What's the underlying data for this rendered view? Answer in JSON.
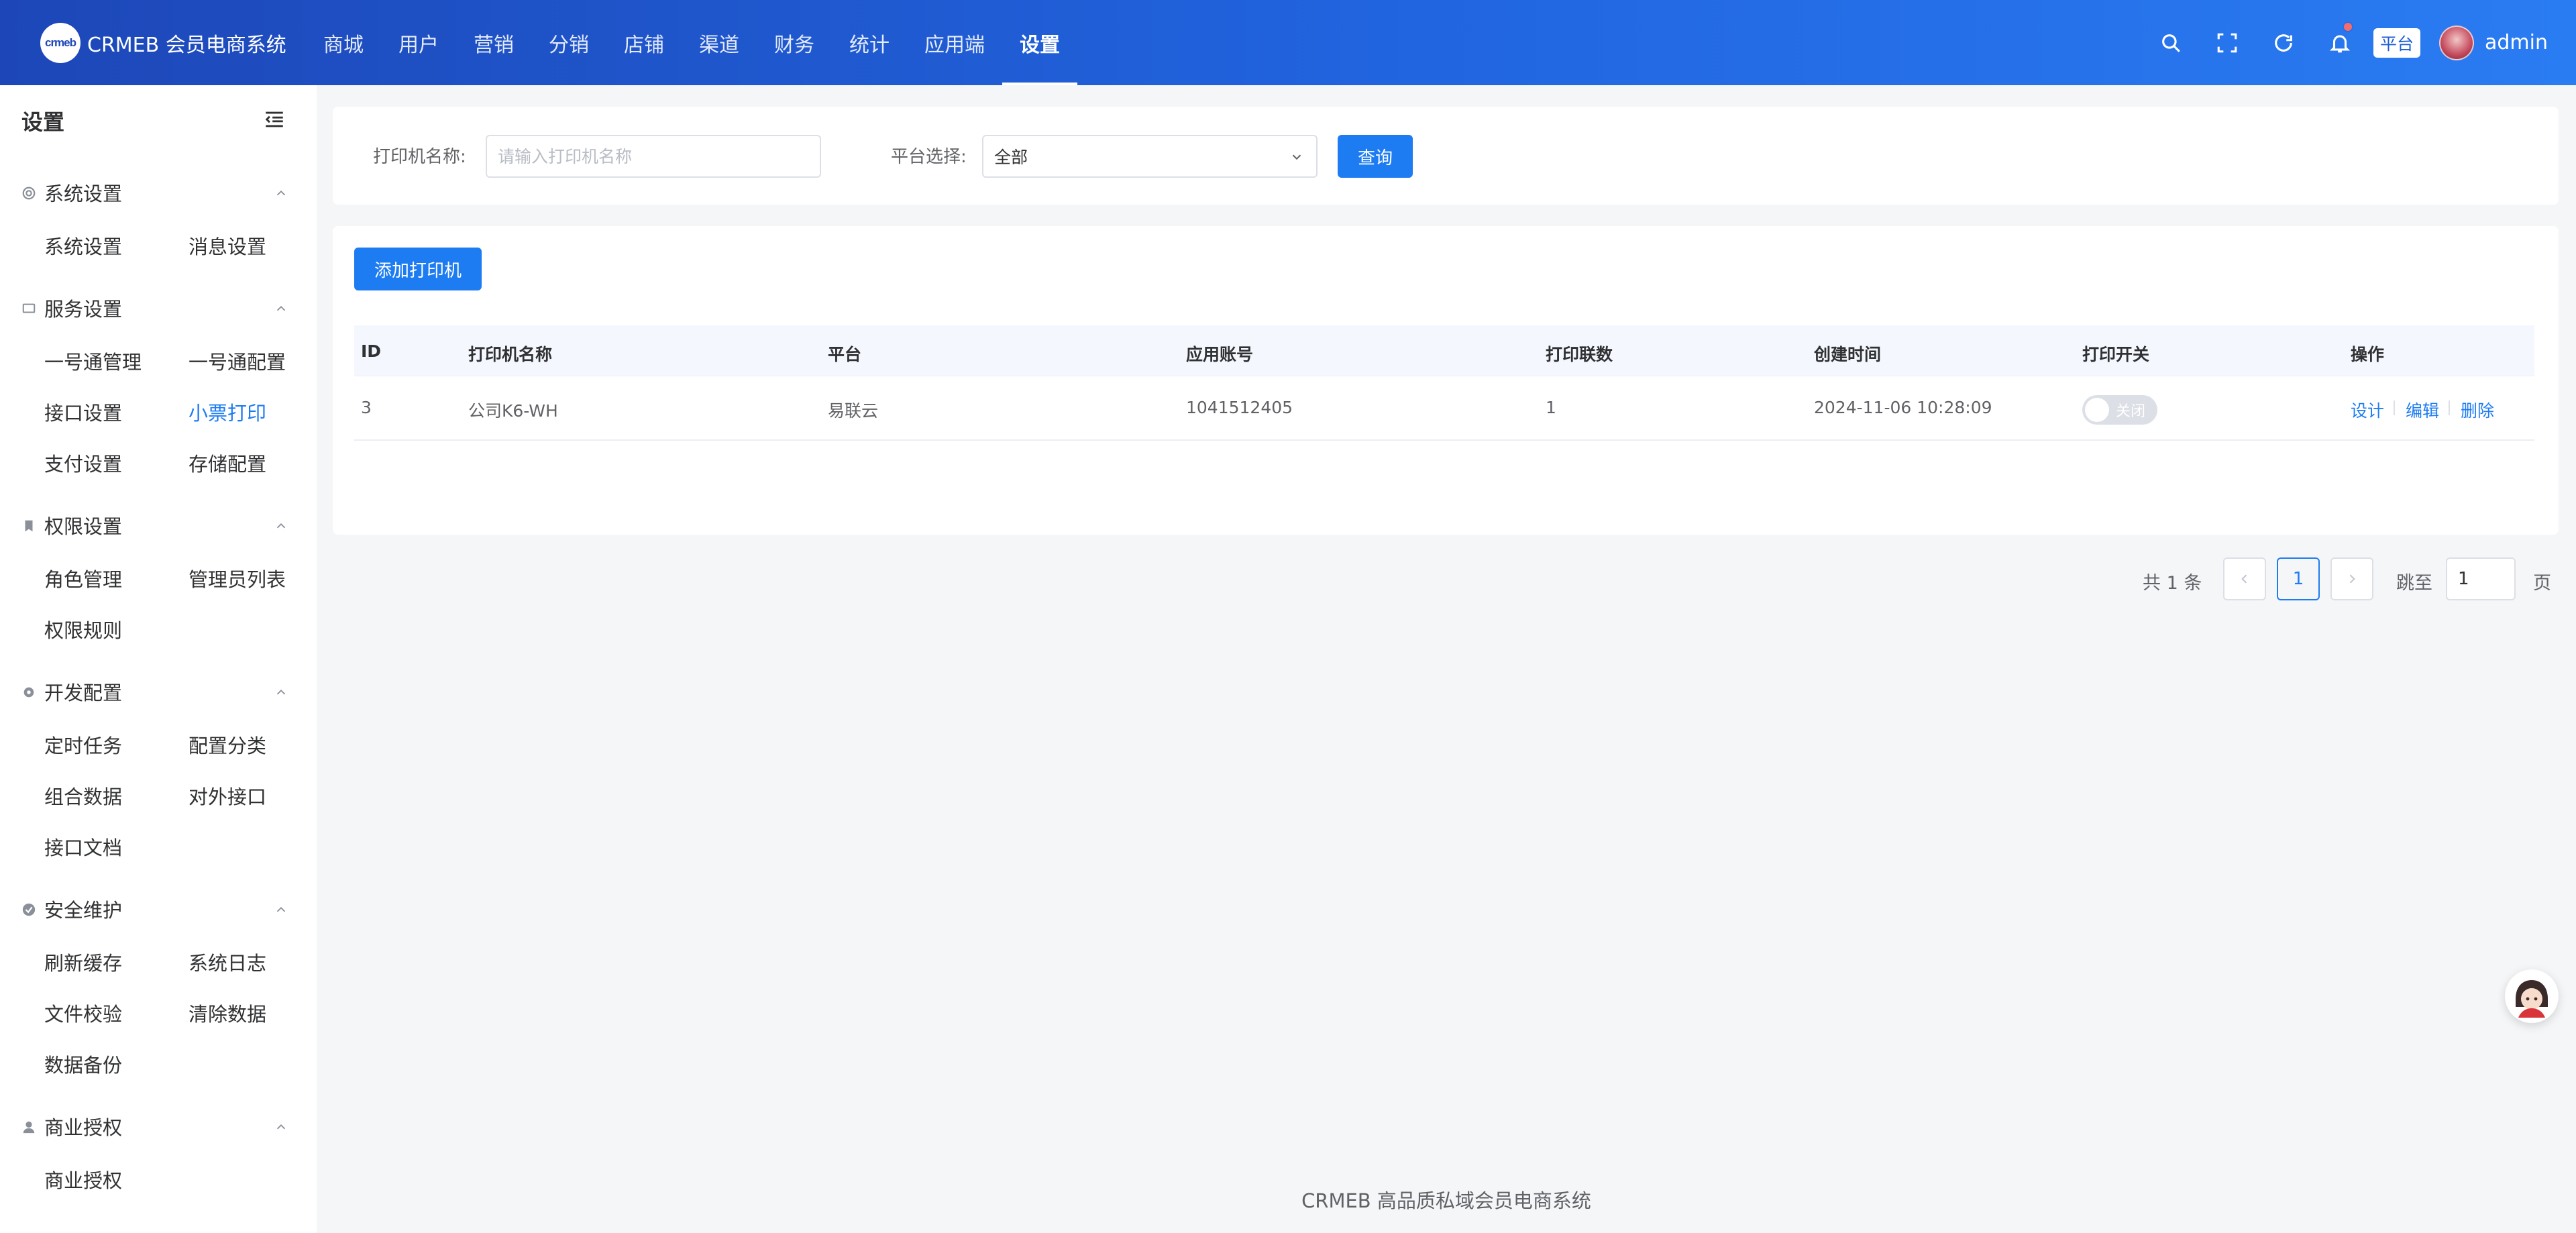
{
  "header": {
    "logo_text": "crmeb",
    "brand": "CRMEB 会员电商系统",
    "nav": [
      {
        "label": "商城"
      },
      {
        "label": "用户"
      },
      {
        "label": "营销"
      },
      {
        "label": "分销"
      },
      {
        "label": "店铺"
      },
      {
        "label": "渠道"
      },
      {
        "label": "财务"
      },
      {
        "label": "统计"
      },
      {
        "label": "应用端"
      },
      {
        "label": "设置",
        "active": true
      }
    ],
    "platform_badge": "平台",
    "username": "admin",
    "icons": [
      "search-icon",
      "fullscreen-icon",
      "refresh-icon",
      "bell-icon"
    ]
  },
  "sidebar": {
    "title": "设置",
    "groups": [
      {
        "title": "系统设置",
        "icon": "gear-icon",
        "items": [
          "系统设置",
          "消息设置"
        ]
      },
      {
        "title": "服务设置",
        "icon": "monitor-icon",
        "items": [
          "一号通管理",
          "一号通配置",
          "接口设置",
          "小票打印",
          "支付设置",
          "存储配置"
        ]
      },
      {
        "title": "权限设置",
        "icon": "bookmark-icon",
        "items": [
          "角色管理",
          "管理员列表",
          "权限规则"
        ]
      },
      {
        "title": "开发配置",
        "icon": "cog-icon",
        "items": [
          "定时任务",
          "配置分类",
          "组合数据",
          "对外接口",
          "接口文档"
        ]
      },
      {
        "title": "安全维护",
        "icon": "check-circle-icon",
        "items": [
          "刷新缓存",
          "系统日志",
          "文件校验",
          "清除数据",
          "数据备份"
        ]
      },
      {
        "title": "商业授权",
        "icon": "user-icon",
        "items": [
          "商业授权"
        ]
      }
    ],
    "active_item": "小票打印"
  },
  "search": {
    "name_label": "打印机名称:",
    "name_placeholder": "请输入打印机名称",
    "platform_label": "平台选择:",
    "platform_value": "全部",
    "query_button": "查询"
  },
  "table": {
    "add_button": "添加打印机",
    "columns": [
      "ID",
      "打印机名称",
      "平台",
      "应用账号",
      "打印联数",
      "创建时间",
      "打印开关",
      "操作"
    ],
    "rows": [
      {
        "id": "3",
        "name": "公司K6-WH",
        "platform": "易联云",
        "account": "1041512405",
        "copies": "1",
        "created": "2024-11-06 10:28:09",
        "switch_label": "关闭",
        "switch_on": false,
        "actions": [
          "设计",
          "编辑",
          "删除"
        ]
      }
    ]
  },
  "pagination": {
    "total": "共 1 条",
    "current": "1",
    "jump_label": "跳至",
    "jump_value": "1",
    "page_label": "页"
  },
  "footer": "CRMEB 高品质私域会员电商系统",
  "colors": {
    "primary": "#1e7cf2",
    "header_start": "#1d47b8",
    "header_end": "#2a7cf2",
    "notification_dot": "#f56c6c"
  }
}
